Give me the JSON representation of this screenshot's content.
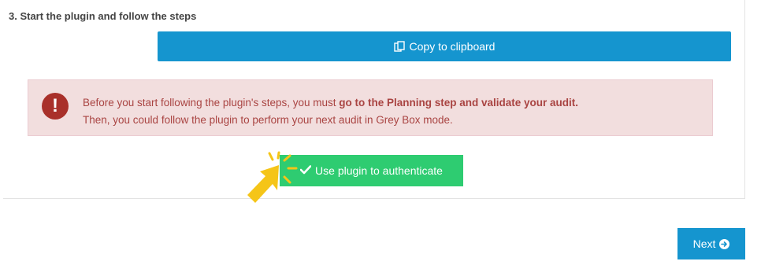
{
  "step": {
    "title": "3. Start the plugin and follow the steps"
  },
  "copy_button": {
    "label": "Copy to clipboard",
    "icon": "clipboard-icon"
  },
  "alert": {
    "icon": "exclamation-icon",
    "line1_prefix": "Before you start following the plugin's steps, you must ",
    "line1_bold": "go to the Planning step and validate your audit.",
    "line2": "Then, you could follow the plugin to perform your next audit in Grey Box mode.",
    "background": "#f2dede",
    "text_color": "#a94442"
  },
  "auth_button": {
    "label": "Use plugin to authenticate",
    "icon": "checkmark-icon",
    "color": "#2ecc71"
  },
  "pointer": {
    "icon": "hand-pointer-arrow-icon",
    "color": "#f5c518"
  },
  "next_button": {
    "label": "Next",
    "icon": "arrow-circle-right-icon",
    "color": "#1595cf"
  }
}
